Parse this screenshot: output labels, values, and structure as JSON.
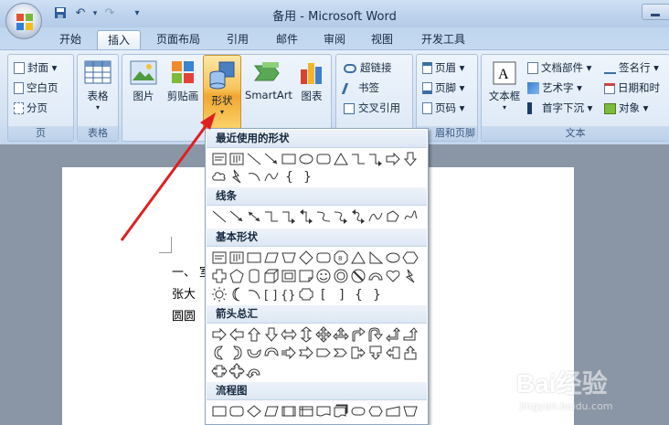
{
  "app": {
    "title": "备用 - Microsoft Word"
  },
  "quick_access": {
    "save": "save-icon",
    "undo": "undo-icon",
    "redo": "redo-icon",
    "customize": "▾"
  },
  "tabs": [
    {
      "label": "开始"
    },
    {
      "label": "插入"
    },
    {
      "label": "页面布局"
    },
    {
      "label": "引用"
    },
    {
      "label": "邮件"
    },
    {
      "label": "审阅"
    },
    {
      "label": "视图"
    },
    {
      "label": "开发工具"
    }
  ],
  "ribbon": {
    "pages_group": {
      "label": "页",
      "cover": "封面",
      "blank": "空白页",
      "break": "分页"
    },
    "table_group": {
      "label": "表格",
      "table": "表格"
    },
    "illustrations": {
      "picture": "图片",
      "clipart": "剪贴画",
      "shapes": "形状",
      "smartart": "SmartArt",
      "chart": "图表"
    },
    "links_group": {
      "hyperlink": "超链接",
      "bookmark": "书签",
      "crossref": "交叉引用"
    },
    "header_footer_group": {
      "label": "眉和页脚",
      "header": "页眉",
      "footer": "页脚",
      "pagenum": "页码"
    },
    "text_group": {
      "label": "文本",
      "textbox": "文本框",
      "quickparts": "文档部件",
      "wordart": "艺术字",
      "dropcap": "首字下沉",
      "signature": "签名行",
      "datetime": "日期和时",
      "object": "对象"
    }
  },
  "shapes_menu": {
    "recent": "最近使用的形状",
    "lines": "线条",
    "basic": "基本形状",
    "arrows": "箭头总汇",
    "flowchart": "流程图"
  },
  "document": {
    "line1": "一、",
    "line1b": "室",
    "line2": "张大",
    "line3": "圆圆"
  },
  "watermark": {
    "brand": "Bai经验",
    "url": "jingyan.baidu.com"
  },
  "colors": {
    "accent": "#f2a631",
    "arrow": "#e02020"
  }
}
